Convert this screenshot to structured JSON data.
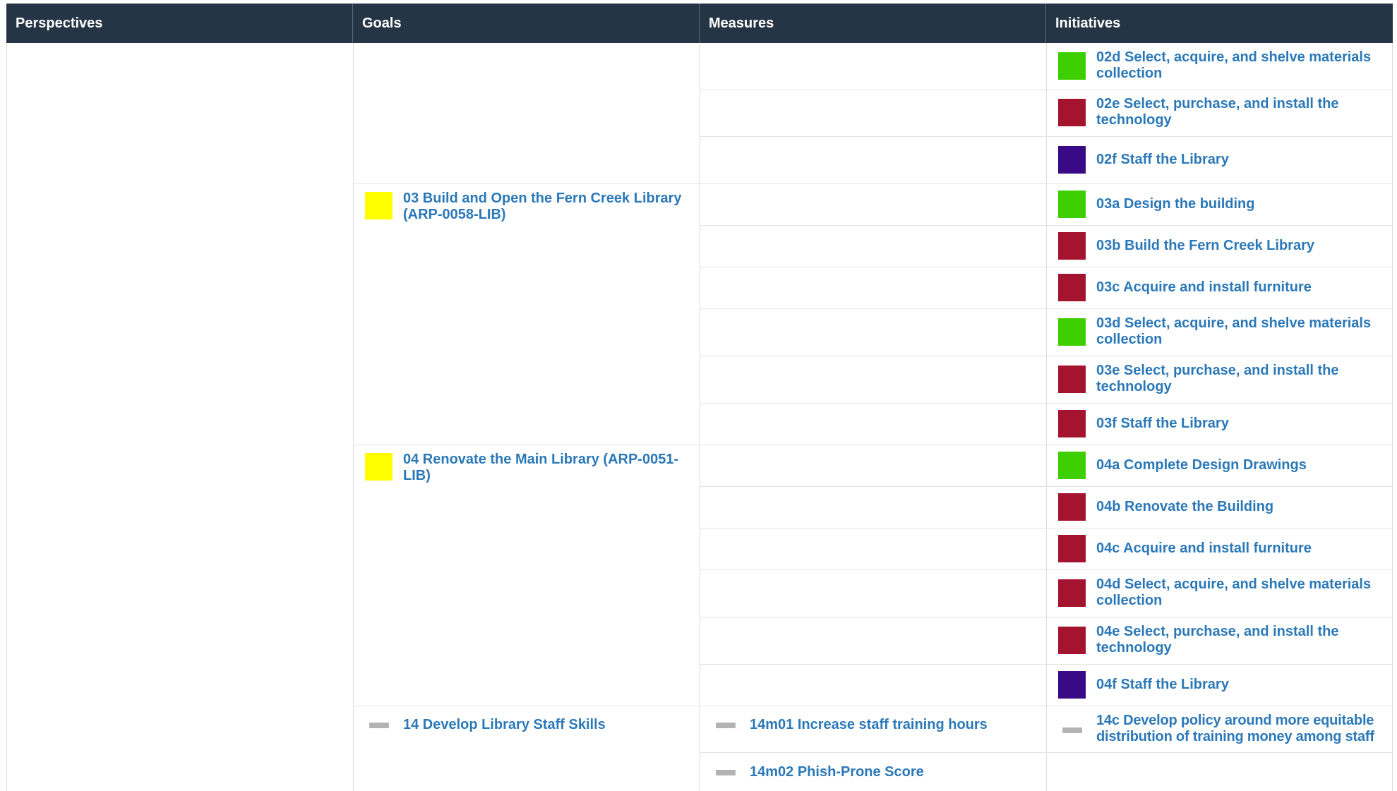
{
  "colors": {
    "header_bg": "#263545",
    "link": "#2b78b8",
    "green": "#3ecf00",
    "red": "#a5142f",
    "purple": "#3a0a86",
    "yellow": "#ffff00",
    "dash": "#b3b3b3"
  },
  "columns": [
    "Perspectives",
    "Goals",
    "Measures",
    "Initiatives"
  ],
  "goals": [
    {
      "label": "03 Build and Open the Fern Creek Library (ARP-0058-LIB)",
      "status": "yellow",
      "icon": "status-square-icon"
    },
    {
      "label": "04 Renovate the Main Library (ARP-0051-LIB)",
      "status": "yellow",
      "icon": "status-square-icon"
    },
    {
      "label": "14 Develop Library Staff Skills",
      "status": "none",
      "icon": "dash-icon"
    }
  ],
  "measures": [
    {
      "label": "14m01 Increase staff training hours",
      "status": "none"
    },
    {
      "label": "14m02 Phish-Prone Score",
      "status": "none"
    }
  ],
  "initiatives": [
    {
      "label": "02d Select, acquire, and shelve materials collection",
      "status": "green"
    },
    {
      "label": "02e Select, purchase, and install the technology",
      "status": "red"
    },
    {
      "label": "02f Staff the Library",
      "status": "purple"
    },
    {
      "label": "03a Design the building",
      "status": "green"
    },
    {
      "label": "03b Build the Fern Creek Library",
      "status": "red"
    },
    {
      "label": "03c Acquire and install furniture",
      "status": "red"
    },
    {
      "label": "03d Select, acquire, and shelve materials collection",
      "status": "green"
    },
    {
      "label": "03e Select, purchase, and install the technology",
      "status": "red"
    },
    {
      "label": "03f Staff the Library",
      "status": "red"
    },
    {
      "label": "04a Complete Design Drawings",
      "status": "green"
    },
    {
      "label": "04b Renovate the Building",
      "status": "red"
    },
    {
      "label": "04c Acquire and install furniture",
      "status": "red"
    },
    {
      "label": "04d Select, acquire, and shelve materials collection",
      "status": "red"
    },
    {
      "label": "04e Select, purchase, and install the technology",
      "status": "red"
    },
    {
      "label": "04f Staff the Library",
      "status": "purple"
    },
    {
      "label": "14c Develop policy around more equitable distribution of training money among staff",
      "status": "none"
    }
  ]
}
